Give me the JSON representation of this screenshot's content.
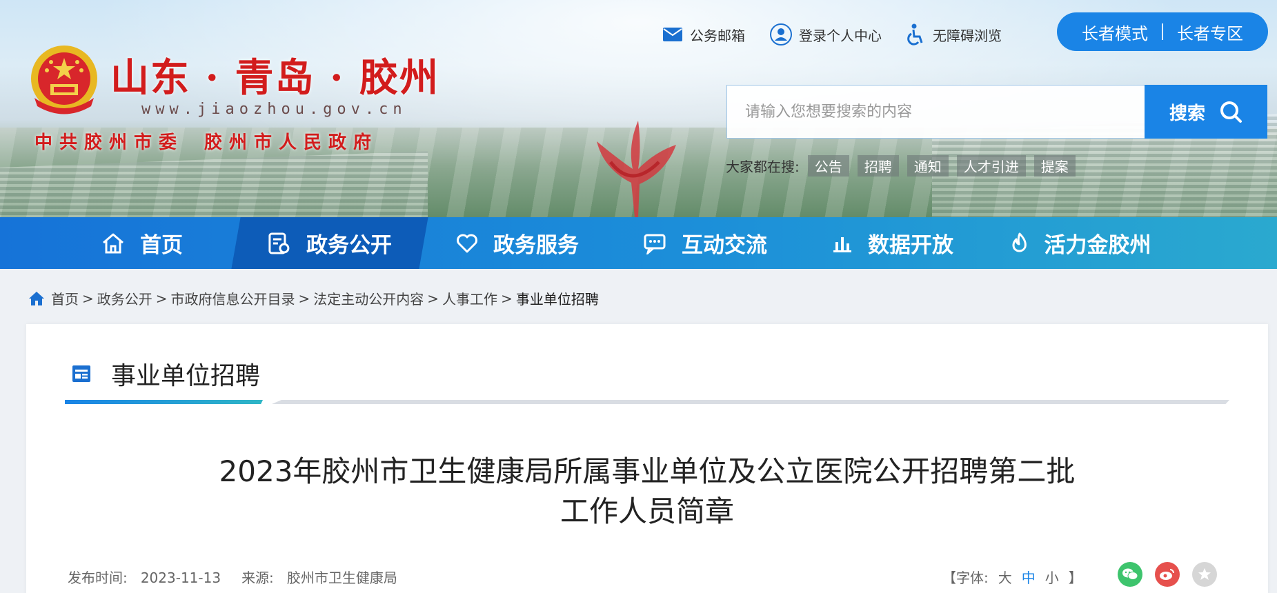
{
  "site": {
    "name": "山东 · 青岛 · 胶州",
    "url": "www.jiaozhou.gov.cn",
    "org_left": "中共胶州市委",
    "org_right": "胶州市人民政府"
  },
  "top_links": [
    {
      "label": "公务邮箱",
      "icon": "mail-icon"
    },
    {
      "label": "登录个人中心",
      "icon": "user-icon"
    },
    {
      "label": "无障碍浏览",
      "icon": "accessibility-icon"
    }
  ],
  "elder": {
    "mode": "长者模式",
    "zone": "长者专区"
  },
  "search": {
    "placeholder": "请输入您想要搜索的内容",
    "button": "搜索",
    "hot_label": "大家都在搜:",
    "hot_tags": [
      "公告",
      "招聘",
      "通知",
      "人才引进",
      "提案"
    ]
  },
  "nav": [
    {
      "label": "首页",
      "icon": "home-icon"
    },
    {
      "label": "政务公开",
      "icon": "document-icon",
      "active": true
    },
    {
      "label": "政务服务",
      "icon": "heart-icon"
    },
    {
      "label": "互动交流",
      "icon": "chat-icon"
    },
    {
      "label": "数据开放",
      "icon": "bar-chart-icon"
    },
    {
      "label": "活力金胶州",
      "icon": "flame-icon"
    }
  ],
  "breadcrumb": [
    "首页",
    "政务公开",
    "市政府信息公开目录",
    "法定主动公开内容",
    "人事工作",
    "事业单位招聘"
  ],
  "section": {
    "title": "事业单位招聘"
  },
  "article": {
    "title_line1": "2023年胶州市卫生健康局所属事业单位及公立医院公开招聘第二批",
    "title_line2": "工作人员简章",
    "publish_label": "发布时间:",
    "publish_date": "2023-11-13",
    "source_label": "来源:",
    "source": "胶州市卫生健康局",
    "font_label_open": "【字体:",
    "font_large": "大",
    "font_medium": "中",
    "font_small": "小",
    "font_label_close": "】"
  },
  "colors": {
    "accent": "#1a84e6",
    "nav_active": "#0d5cb8",
    "brand_red": "#d21c1c",
    "wechat": "#3ec46d",
    "weibo": "#e6504d",
    "favorite": "#d6d6d6"
  }
}
